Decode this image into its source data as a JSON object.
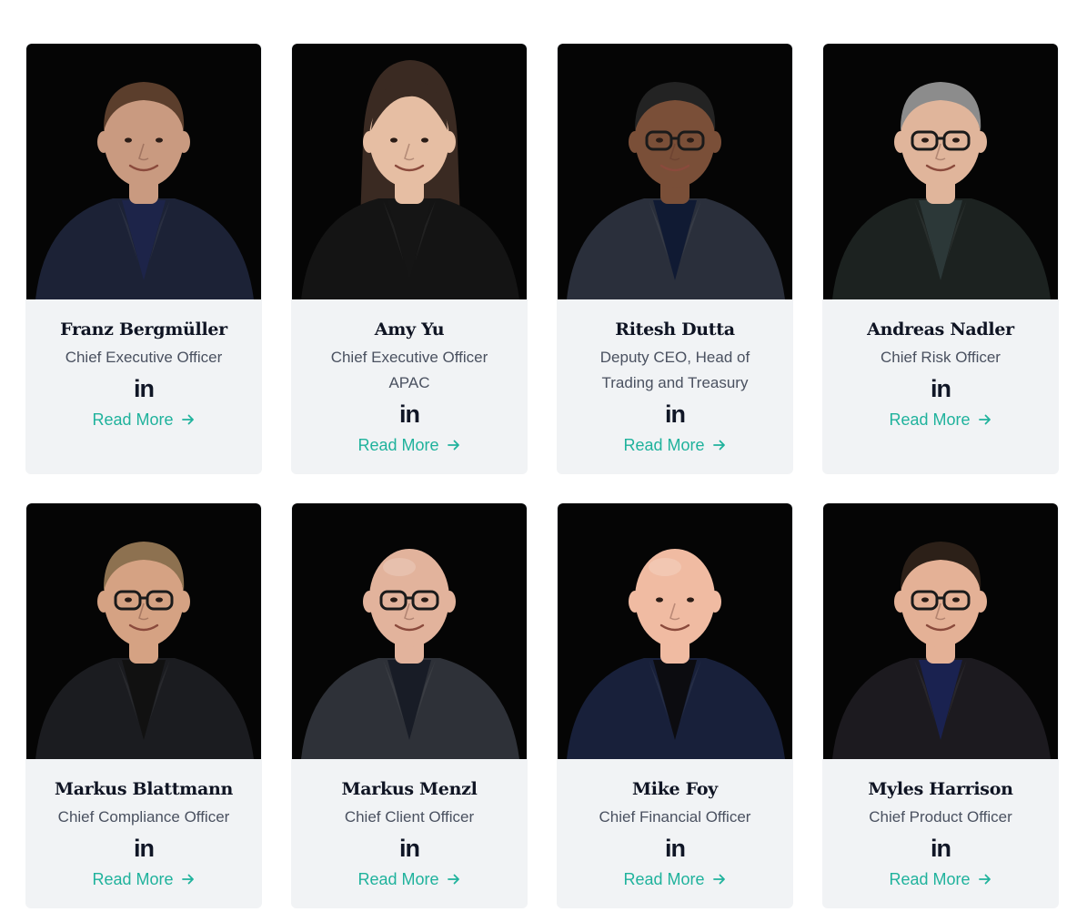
{
  "accent": "#1fb29c",
  "card_background": "#f1f3f5",
  "team": [
    {
      "name": "Franz Bergmüller",
      "role": "Chief Executive Officer",
      "linkedin_label": "in",
      "read_more": "Read More",
      "photo": {
        "bg": "#050505",
        "skin": "#c99a80",
        "hair": "#5b3e2c",
        "jacket": "#1c2236",
        "shirt": "#1d2449",
        "glasses": false,
        "bald": false,
        "long_hair": false
      }
    },
    {
      "name": "Amy Yu",
      "role": "Chief Executive Officer\nAPAC",
      "linkedin_label": "in",
      "read_more": "Read More",
      "photo": {
        "bg": "#050505",
        "skin": "#e6bea3",
        "hair": "#3a2a22",
        "jacket": "#141414",
        "shirt": "#151515",
        "glasses": false,
        "bald": false,
        "long_hair": true
      }
    },
    {
      "name": "Ritesh Dutta",
      "role": "Deputy CEO, Head of\nTrading and Treasury",
      "linkedin_label": "in",
      "read_more": "Read More",
      "photo": {
        "bg": "#050505",
        "skin": "#7a4f38",
        "hair": "#232323",
        "jacket": "#2a2f3b",
        "shirt": "#101a33",
        "glasses": true,
        "bald": false,
        "long_hair": false
      }
    },
    {
      "name": "Andreas Nadler",
      "role": "Chief Risk Officer",
      "linkedin_label": "in",
      "read_more": "Read More",
      "photo": {
        "bg": "#050505",
        "skin": "#e0b59b",
        "hair": "#8c8c8c",
        "jacket": "#1c2220",
        "shirt": "#2c3838",
        "glasses": true,
        "bald": false,
        "long_hair": false
      }
    },
    {
      "name": "Markus Blattmann",
      "role": "Chief Compliance Officer",
      "linkedin_label": "in",
      "read_more": "Read More",
      "photo": {
        "bg": "#050505",
        "skin": "#d5a283",
        "hair": "#8d7150",
        "jacket": "#1b1c20",
        "shirt": "#111111",
        "glasses": true,
        "bald": false,
        "long_hair": false
      }
    },
    {
      "name": "Markus Menzl",
      "role": "Chief Client Officer",
      "linkedin_label": "in",
      "read_more": "Read More",
      "photo": {
        "bg": "#050505",
        "skin": "#e2b39c",
        "hair": "#e2b39c",
        "jacket": "#2e3138",
        "shirt": "#181c26",
        "glasses": true,
        "bald": true,
        "long_hair": false
      }
    },
    {
      "name": "Mike Foy",
      "role": "Chief Financial Officer",
      "linkedin_label": "in",
      "read_more": "Read More",
      "photo": {
        "bg": "#050505",
        "skin": "#f0bba2",
        "hair": "#f0bba2",
        "jacket": "#18203a",
        "shirt": "#0c0c10",
        "glasses": false,
        "bald": true,
        "long_hair": false
      }
    },
    {
      "name": "Myles Harrison",
      "role": "Chief Product Officer",
      "linkedin_label": "in",
      "read_more": "Read More",
      "photo": {
        "bg": "#050505",
        "skin": "#e4b196",
        "hair": "#2c2018",
        "jacket": "#1c1a1f",
        "shirt": "#1a2250",
        "glasses": true,
        "bald": false,
        "long_hair": false
      }
    }
  ]
}
